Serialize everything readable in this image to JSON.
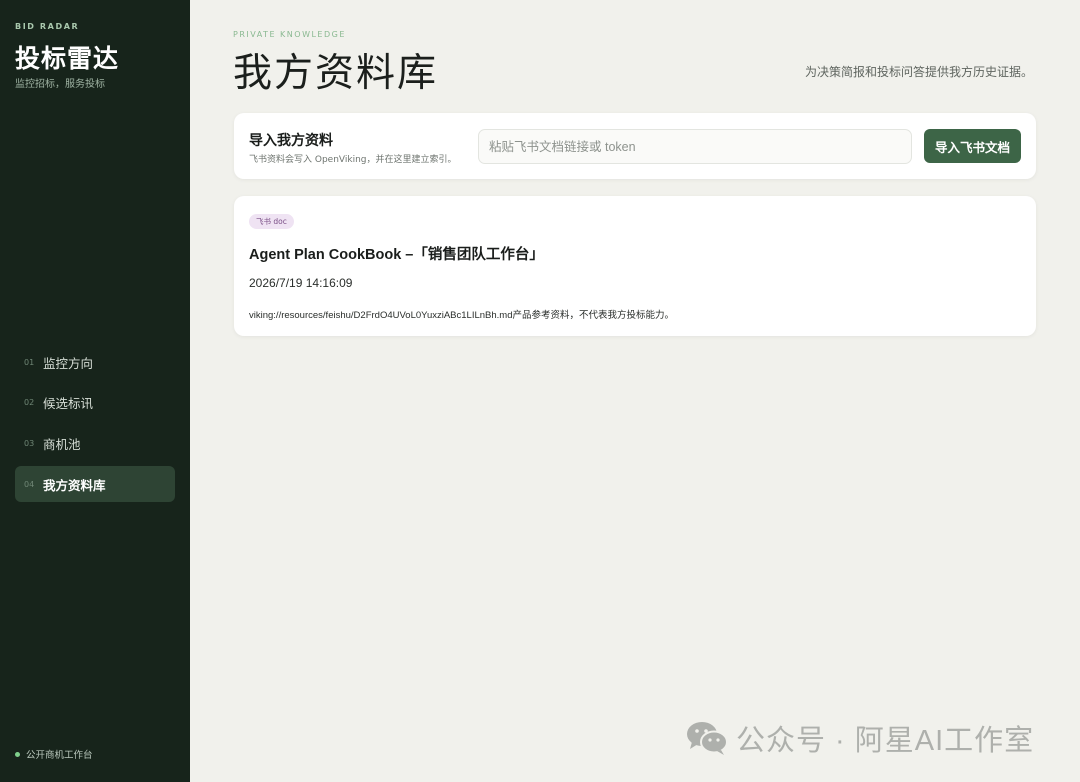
{
  "sidebar": {
    "brand_en": "BID RADAR",
    "brand_cn": "投标雷达",
    "brand_sub": "监控招标，服务投标",
    "items": [
      {
        "num": "01",
        "label": "监控方向",
        "active": false
      },
      {
        "num": "02",
        "label": "候选标讯",
        "active": false
      },
      {
        "num": "03",
        "label": "商机池",
        "active": false
      },
      {
        "num": "04",
        "label": "我方资料库",
        "active": true
      }
    ],
    "footer": "公开商机工作台"
  },
  "header": {
    "eyebrow": "PRIVATE KNOWLEDGE",
    "title": "我方资料库",
    "subtitle": "为决策简报和投标问答提供我方历史证据。"
  },
  "import": {
    "title": "导入我方资料",
    "desc": "飞书资料会写入 OpenViking，并在这里建立索引。",
    "placeholder": "粘贴飞书文档链接或 token",
    "value": "",
    "button": "导入飞书文档"
  },
  "documents": [
    {
      "tag": "飞书 doc",
      "title": "Agent Plan CookBook –「销售团队工作台」",
      "time": "2026/7/19 14:16:09",
      "path": "viking://resources/feishu/D2FrdO4UVoL0YuxziABc1LILnBh.md产品参考资料，不代表我方投标能力。"
    }
  ],
  "watermark": {
    "text": "公众号 · 阿星AI工作室",
    "icon": "wechat-icon"
  },
  "colors": {
    "sidebar_bg": "#17241b",
    "page_bg": "#f1f1ec",
    "accent": "#3d6547",
    "nav_active": "#2e4434",
    "status_dot": "#7fd08c"
  }
}
